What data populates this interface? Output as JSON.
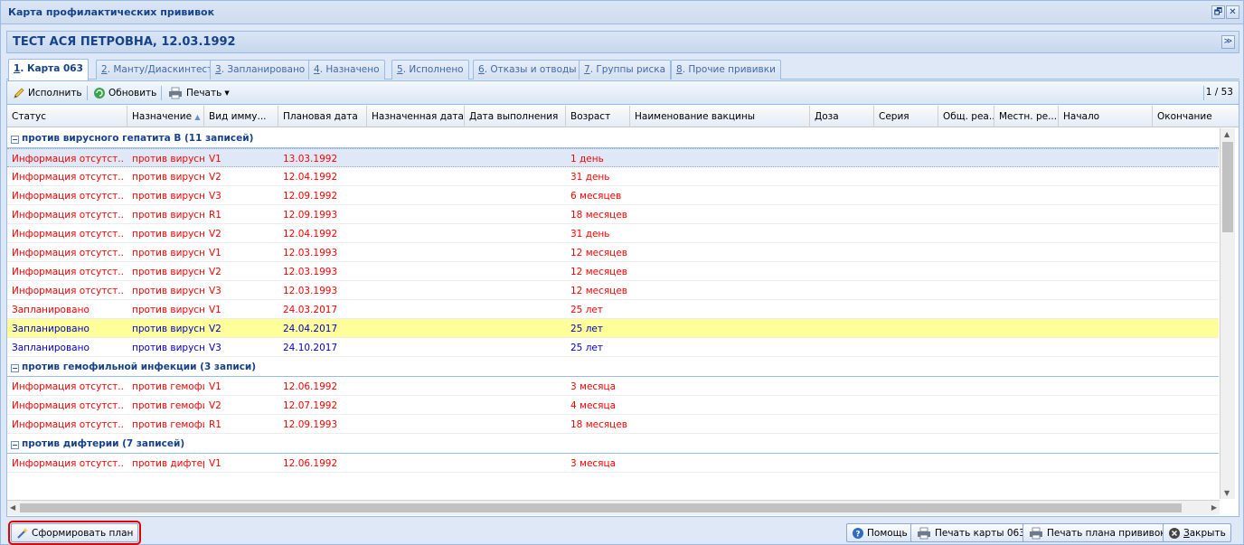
{
  "window": {
    "title": "Карта профилактических прививок"
  },
  "patient": {
    "name": "ТЕСТ АСЯ ПЕТРОВНА, 12.03.1992"
  },
  "tabs": [
    {
      "num": "1",
      "label": ". Карта 063",
      "active": true
    },
    {
      "num": "2",
      "label": ". Манту/Диаскинтест"
    },
    {
      "num": "3",
      "label": ". Запланировано"
    },
    {
      "num": "4",
      "label": ". Назначено"
    },
    {
      "num": "5",
      "label": ". Исполнено"
    },
    {
      "num": "6",
      "label": ". Отказы и отводы"
    },
    {
      "num": "7",
      "label": ". Группы риска"
    },
    {
      "num": "8",
      "label": ". Прочие прививки"
    }
  ],
  "toolbar": {
    "execute_label": "Исполнить",
    "refresh_label": "Обновить",
    "print_label": "Печать",
    "page_info": "1 / 53"
  },
  "columns": [
    "Статус",
    "Назначение",
    "Вид имму...",
    "Плановая дата",
    "Назначенная дата",
    "Дата выполнения",
    "Возраст",
    "Наименование вакцины",
    "Доза",
    "Серия",
    "Общ. реа...",
    "Местн. ре...",
    "Начало",
    "Окончание"
  ],
  "groups": [
    {
      "title": "против вирусного гепатита В (11 записей)",
      "rows": [
        {
          "status": "Информация отсутст...",
          "purpose": "против вирусно...",
          "kind": "V1",
          "plan": "13.03.1992",
          "age": "1 день",
          "color": "red",
          "selected": true
        },
        {
          "status": "Информация отсутст...",
          "purpose": "против вирусно...",
          "kind": "V2",
          "plan": "12.04.1992",
          "age": "31 день",
          "color": "red"
        },
        {
          "status": "Информация отсутст...",
          "purpose": "против вирусно...",
          "kind": "V3",
          "plan": "12.09.1992",
          "age": "6 месяцев",
          "color": "red"
        },
        {
          "status": "Информация отсутст...",
          "purpose": "против вирусно...",
          "kind": "R1",
          "plan": "12.09.1993",
          "age": "18 месяцев",
          "color": "red"
        },
        {
          "status": "Информация отсутст...",
          "purpose": "против вирусно...",
          "kind": "V2",
          "plan": "12.04.1992",
          "age": "31 день",
          "color": "red"
        },
        {
          "status": "Информация отсутст...",
          "purpose": "против вирусно...",
          "kind": "V1",
          "plan": "12.03.1993",
          "age": "12 месяцев",
          "color": "red"
        },
        {
          "status": "Информация отсутст...",
          "purpose": "против вирусно...",
          "kind": "V2",
          "plan": "12.03.1993",
          "age": "12 месяцев",
          "color": "red"
        },
        {
          "status": "Информация отсутст...",
          "purpose": "против вирусно...",
          "kind": "V3",
          "plan": "12.03.1993",
          "age": "12 месяцев",
          "color": "red"
        },
        {
          "status": "Запланировано",
          "purpose": "против вирусно...",
          "kind": "V1",
          "plan": "24.03.2017",
          "age": "25 лет",
          "color": "red"
        },
        {
          "status": "Запланировано",
          "purpose": "против вирусно...",
          "kind": "V2",
          "plan": "24.04.2017",
          "age": "25 лет",
          "color": "blue",
          "highlight": true
        },
        {
          "status": "Запланировано",
          "purpose": "против вирусно...",
          "kind": "V3",
          "plan": "24.10.2017",
          "age": "25 лет",
          "color": "blue"
        }
      ]
    },
    {
      "title": "против гемофильной инфекции (3 записи)",
      "rows": [
        {
          "status": "Информация отсутст...",
          "purpose": "против гемофи...",
          "kind": "V1",
          "plan": "12.06.1992",
          "age": "3 месяца",
          "color": "red"
        },
        {
          "status": "Информация отсутст...",
          "purpose": "против гемофи...",
          "kind": "V2",
          "plan": "12.07.1992",
          "age": "4 месяца",
          "color": "red"
        },
        {
          "status": "Информация отсутст...",
          "purpose": "против гемофи...",
          "kind": "R1",
          "plan": "12.09.1993",
          "age": "18 месяцев",
          "color": "red"
        }
      ]
    },
    {
      "title": "против дифтерии (7 записей)",
      "rows": [
        {
          "status": "Информация отсутст...",
          "purpose": "против дифтерии",
          "kind": "V1",
          "plan": "12.06.1992",
          "age": "3 месяца",
          "color": "red"
        }
      ]
    }
  ],
  "footer": {
    "form_plan_label": "Сформировать план",
    "help_label": "Помощь",
    "print_card_label": "Печать карты 063",
    "print_plan_label": "Печать плана прививок",
    "close_label": "Закрыть",
    "close_hotkey": "З",
    "close_rest": "акрыть"
  },
  "icons": {
    "execute": "pencil-icon",
    "refresh": "refresh-icon",
    "print": "printer-icon",
    "form_plan": "wand-icon",
    "help": "help-icon",
    "close": "close-icon"
  }
}
